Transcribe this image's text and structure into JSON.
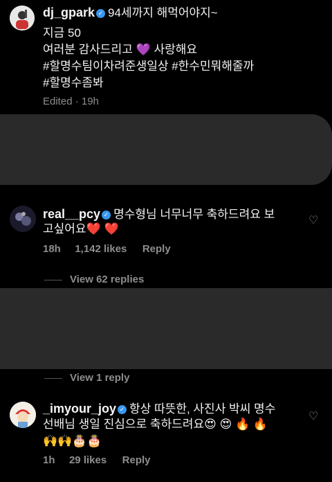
{
  "post": {
    "username": "dj_gpark",
    "line1": "94세까지 해먹어야지~",
    "line2": "지금 50",
    "line3": "여러분 감사드리고 💜 사랑해요",
    "line4": "#할명수팀이차려준생일상 #한수민뭐해줄까",
    "line5": "#할명수좀봐",
    "meta": "Edited · 19h"
  },
  "comments": [
    {
      "username": "real__pcy",
      "text1": "명수형님 너무너무 축하드려요 보",
      "text2": "고싶어요❤️ ❤️",
      "time": "18h",
      "likes": "1,142 likes",
      "reply_label": "Reply",
      "view_replies": "View 62 replies"
    },
    {
      "view_replies": "View 1 reply"
    },
    {
      "username": "_imyour_joy",
      "text1": "항상 따뜻한, 사진사 박씨 명수",
      "text2": "선배님 생일 진심으로 축하드려요😍 😍 🔥 🔥",
      "text3": "🙌🙌🎂🎂",
      "time": "1h",
      "likes": "29 likes",
      "reply_label": "Reply"
    }
  ],
  "colors": {
    "background": "#000000",
    "verified": "#3897f0",
    "muted": "#8e8e8e",
    "hidden_block": "#2a2a2a"
  }
}
